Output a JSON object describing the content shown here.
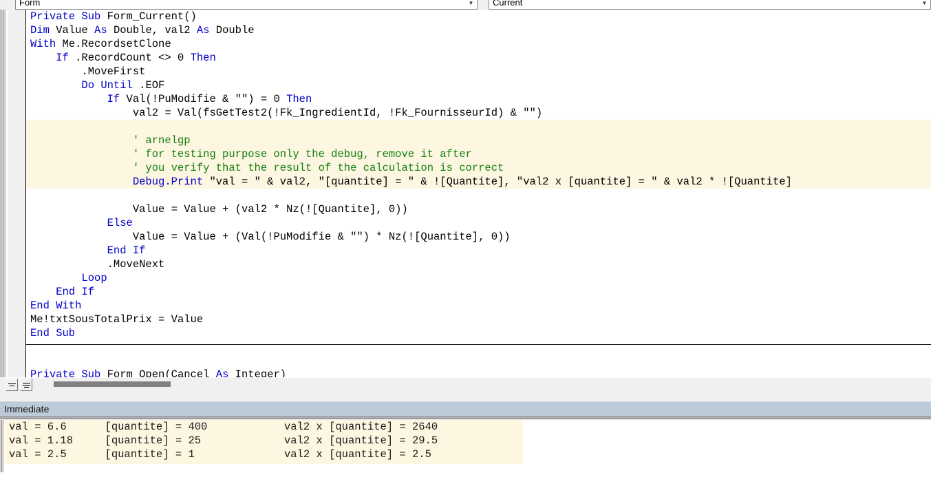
{
  "toolbar": {
    "object_combo": {
      "value": "Form",
      "arrow_icon": "chevron-down-icon"
    },
    "procedure_combo": {
      "value": "Current",
      "arrow_icon": "chevron-down-icon"
    }
  },
  "code": {
    "lines": [
      {
        "highlight": false,
        "tokens": [
          {
            "t": "kw",
            "s": "Private Sub "
          },
          {
            "t": "id",
            "s": "Form_Current()"
          }
        ]
      },
      {
        "highlight": false,
        "tokens": [
          {
            "t": "kw",
            "s": "Dim "
          },
          {
            "t": "id",
            "s": "Value "
          },
          {
            "t": "kw",
            "s": "As "
          },
          {
            "t": "id",
            "s": "Double, val2 "
          },
          {
            "t": "kw",
            "s": "As "
          },
          {
            "t": "id",
            "s": "Double"
          }
        ]
      },
      {
        "highlight": false,
        "tokens": [
          {
            "t": "kw",
            "s": "With "
          },
          {
            "t": "id",
            "s": "Me.RecordsetClone"
          }
        ]
      },
      {
        "highlight": false,
        "tokens": [
          {
            "t": "id",
            "s": "    "
          },
          {
            "t": "kw",
            "s": "If "
          },
          {
            "t": "id",
            "s": ".RecordCount <> 0 "
          },
          {
            "t": "kw",
            "s": "Then"
          }
        ]
      },
      {
        "highlight": false,
        "tokens": [
          {
            "t": "id",
            "s": "        .MoveFirst"
          }
        ]
      },
      {
        "highlight": false,
        "tokens": [
          {
            "t": "id",
            "s": "        "
          },
          {
            "t": "kw",
            "s": "Do Until "
          },
          {
            "t": "id",
            "s": ".EOF"
          }
        ]
      },
      {
        "highlight": false,
        "tokens": [
          {
            "t": "id",
            "s": "            "
          },
          {
            "t": "kw",
            "s": "If "
          },
          {
            "t": "id",
            "s": "Val(!PuModifie & \"\") = 0 "
          },
          {
            "t": "kw",
            "s": "Then"
          }
        ]
      },
      {
        "highlight": false,
        "tokens": [
          {
            "t": "id",
            "s": "                val2 = Val(fsGetTest2(!Fk_IngredientId, !Fk_FournisseurId) & \"\")"
          }
        ]
      },
      {
        "highlight": true,
        "tokens": [
          {
            "t": "id",
            "s": ""
          }
        ]
      },
      {
        "highlight": true,
        "tokens": [
          {
            "t": "cm",
            "s": "                ' arnelgp"
          }
        ]
      },
      {
        "highlight": true,
        "tokens": [
          {
            "t": "cm",
            "s": "                ' for testing purpose only the debug, remove it after"
          }
        ]
      },
      {
        "highlight": true,
        "tokens": [
          {
            "t": "cm",
            "s": "                ' you verify that the result of the calculation is correct"
          }
        ]
      },
      {
        "highlight": true,
        "tokens": [
          {
            "t": "kw",
            "s": "                Debug.Print "
          },
          {
            "t": "id",
            "s": "\"val = \" & val2, \"[quantite] = \" & ![Quantite], \"val2 x [quantite] = \" & val2 * ![Quantite]"
          }
        ]
      },
      {
        "highlight": false,
        "tokens": [
          {
            "t": "id",
            "s": ""
          }
        ]
      },
      {
        "highlight": false,
        "tokens": [
          {
            "t": "id",
            "s": "                Value = Value + (val2 * Nz(![Quantite], 0))"
          }
        ]
      },
      {
        "highlight": false,
        "tokens": [
          {
            "t": "id",
            "s": "            "
          },
          {
            "t": "kw",
            "s": "Else"
          }
        ]
      },
      {
        "highlight": false,
        "tokens": [
          {
            "t": "id",
            "s": "                Value = Value + (Val(!PuModifie & \"\") * Nz(![Quantite], 0))"
          }
        ]
      },
      {
        "highlight": false,
        "tokens": [
          {
            "t": "id",
            "s": "            "
          },
          {
            "t": "kw",
            "s": "End If"
          }
        ]
      },
      {
        "highlight": false,
        "tokens": [
          {
            "t": "id",
            "s": "            .MoveNext"
          }
        ]
      },
      {
        "highlight": false,
        "tokens": [
          {
            "t": "id",
            "s": "        "
          },
          {
            "t": "kw",
            "s": "Loop"
          }
        ]
      },
      {
        "highlight": false,
        "tokens": [
          {
            "t": "id",
            "s": "    "
          },
          {
            "t": "kw",
            "s": "End If"
          }
        ]
      },
      {
        "highlight": false,
        "tokens": [
          {
            "t": "kw",
            "s": "End With"
          }
        ]
      },
      {
        "highlight": false,
        "tokens": [
          {
            "t": "id",
            "s": "Me!txtSousTotalPrix = Value"
          }
        ]
      },
      {
        "highlight": false,
        "tokens": [
          {
            "t": "kw",
            "s": "End Sub"
          }
        ]
      },
      {
        "highlight": false,
        "tokens": [
          {
            "t": "id",
            "s": ""
          }
        ]
      },
      {
        "highlight": false,
        "tokens": [
          {
            "t": "id",
            "s": ""
          }
        ]
      },
      {
        "highlight": false,
        "tokens": [
          {
            "t": "kw",
            "s": "Private Sub "
          },
          {
            "t": "id",
            "s": "Form_Open(Cancel "
          },
          {
            "t": "kw",
            "s": "As "
          },
          {
            "t": "id",
            "s": "Integer)"
          }
        ]
      }
    ],
    "colors": {
      "keyword": "#0000c8",
      "comment": "#108010",
      "identifier": "#000000",
      "highlight_background": "#fdf6e0"
    }
  },
  "footer": {
    "procedure_view_button": "procedure-view",
    "full_module_view_button": "full-module-view"
  },
  "immediate": {
    "title": "Immediate",
    "lines": [
      "val = 6.6      [quantite] = 400            val2 x [quantite] = 2640",
      "val = 1.18     [quantite] = 25             val2 x [quantite] = 29.5",
      "val = 2.5      [quantite] = 1              val2 x [quantite] = 2.5"
    ]
  }
}
